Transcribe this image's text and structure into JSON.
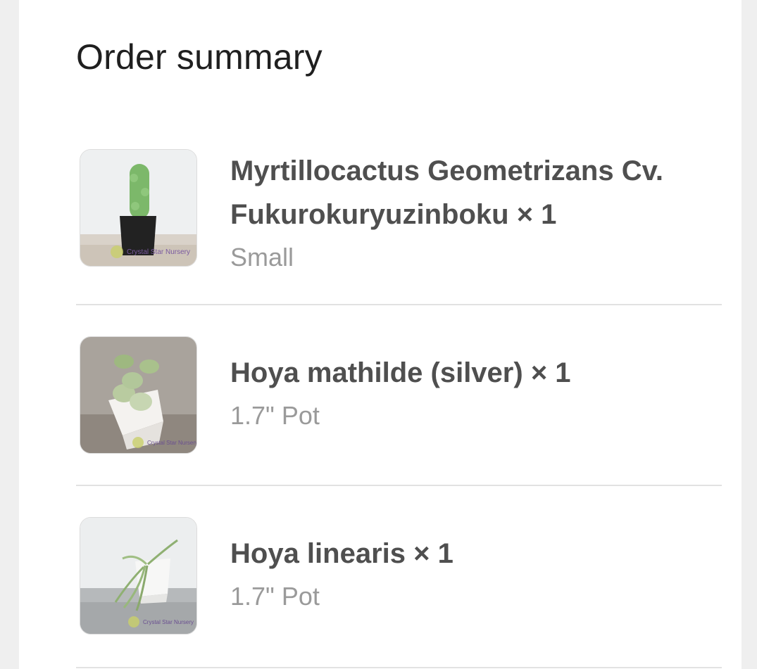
{
  "order_summary": {
    "title": "Order summary",
    "items": [
      {
        "name": "Myrtillocactus Geometrizans Cv. Fukurokuryuzinboku",
        "quantity": "× 1",
        "variant": "Small",
        "watermark": "Crystal Star Nursery"
      },
      {
        "name": "Hoya mathilde (silver)",
        "quantity": "× 1",
        "variant": "1.7\" Pot",
        "watermark": "Crystal Star Nursery"
      },
      {
        "name": "Hoya linearis",
        "quantity": "× 1",
        "variant": "1.7\" Pot",
        "watermark": "Crystal Star Nursery"
      }
    ]
  },
  "colors": {
    "background": "#efefef",
    "card": "#ffffff",
    "title_text": "#1f1f1f",
    "name_text": "#4f4f4f",
    "variant_text": "#9a9a9a",
    "divider": "#e2e2e2"
  }
}
